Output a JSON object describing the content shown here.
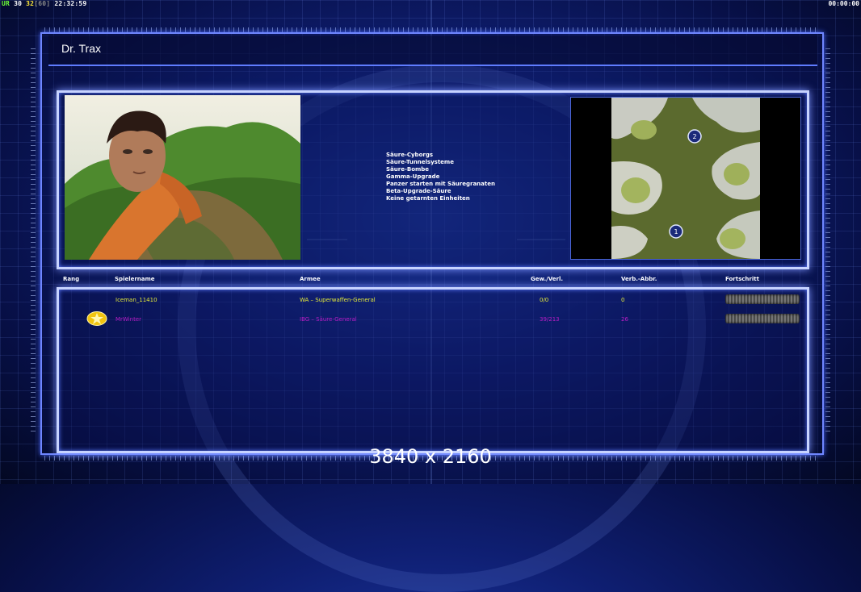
{
  "hud": {
    "ur": "UR",
    "num1": "30",
    "num2": "32",
    "num3": "[60]",
    "clock": "22:32:59",
    "timer": "00:00:00"
  },
  "title": "Dr. Trax",
  "features": [
    "Säure-Cyborgs",
    "Säure-Tunnelsysteme",
    "Säure-Bombe",
    "Gamma-Upgrade",
    "Panzer starten mit Säuregranaten",
    "Beta-Upgrade-Säure",
    "Keine getarnten Einheiten"
  ],
  "map": {
    "start_1": "1",
    "start_2": "2"
  },
  "table": {
    "headers": {
      "rank": "Rang",
      "player": "Spielername",
      "army": "Armee",
      "winloss": "Gew./Verl.",
      "disconnects": "Verb.-Abbr.",
      "progress": "Fortschritt"
    },
    "rows": [
      {
        "player": "Iceman_11410",
        "army": "WA – Superwaffen-General",
        "winloss": "0/0",
        "disconnects": "0",
        "color": "#e4ea38"
      },
      {
        "player": "MrWinter",
        "army": "IBG – Säure-General",
        "winloss": "39/213",
        "disconnects": "26",
        "color": "#b81cc4"
      }
    ]
  },
  "resolution_label": "3840 x 2160",
  "colors": {
    "frame": "#6f86ff",
    "panel_border": "#c7d3ff",
    "background": "#0f1f73"
  }
}
